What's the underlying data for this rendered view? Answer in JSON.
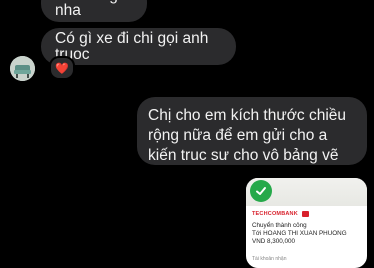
{
  "messages": {
    "incoming_1": "Mai sáng nha",
    "incoming_2": "Có gì xe đi chi gọi anh truoc",
    "reaction": "❤️",
    "outgoing_1": "Chị cho em kích thước chiều rộng nữa để em gửi cho a kiến truc sư cho vô bảng vẽ"
  },
  "receipt": {
    "bank": "TECHCOMBANK",
    "status": "Chuyển thành công",
    "recipient": "Tới HOANG THI XUAN PHUONG",
    "amount": "VND 8,300,000",
    "footer": "Tài khoản nhận"
  },
  "colors": {
    "background": "#000000",
    "bubble": "#2b2b2d",
    "success_green": "#26a94a",
    "bank_red": "#d8212c"
  }
}
